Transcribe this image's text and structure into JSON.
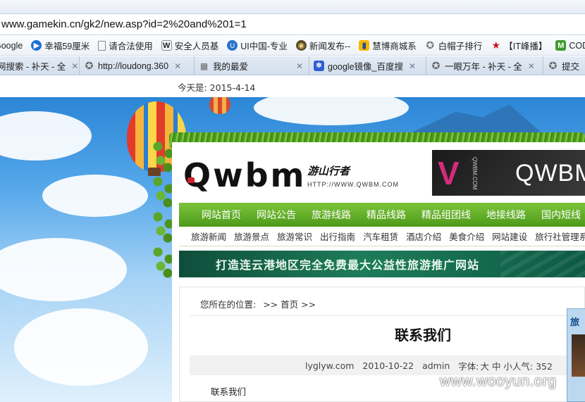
{
  "browser": {
    "address": "www.gamekin.cn/gk2/new.asp?id=2%20and%201=1",
    "bookmarks": [
      {
        "label": "Google",
        "icon": "google-icon"
      },
      {
        "label": "幸福59厘米",
        "icon": "play-circle-icon"
      },
      {
        "label": "请合法使用",
        "icon": "page-icon"
      },
      {
        "label": "安全人员基",
        "icon": "wikipedia-icon"
      },
      {
        "label": "UI中国-专业",
        "icon": "ui-china-icon"
      },
      {
        "label": "新闻发布--",
        "icon": "globe-icon"
      },
      {
        "label": "慧博商城系",
        "icon": "huibo-icon"
      },
      {
        "label": "白帽子排行",
        "icon": "star-outline-icon"
      },
      {
        "label": "【IT峰播】",
        "icon": "red-star-icon"
      },
      {
        "label": "CODEC",
        "icon": "codec-icon"
      }
    ],
    "tabs": [
      {
        "label": "网搜索 - 补天 - 全",
        "icon": "none"
      },
      {
        "label": "http://loudong.360",
        "icon": "star-outline-icon"
      },
      {
        "label": "我的最爱",
        "icon": "grid-icon"
      },
      {
        "label": "google镜像_百度搜",
        "icon": "baidu-paw-icon"
      },
      {
        "label": "一眼万年 - 补天 - 全",
        "icon": "star-outline-icon"
      },
      {
        "label": "提交",
        "icon": "star-outline-icon"
      }
    ],
    "today": "今天是: 2015-4-14"
  },
  "site": {
    "logo_text": "Qwbm",
    "logo_cn": "游山行者",
    "logo_url": "HTTP://WWW.QWBM.COM",
    "banner_v": "V",
    "banner_small": "QWBM.COM",
    "banner_text": "QWBM",
    "main_nav": [
      "网站首页",
      "网站公告",
      "旅游线路",
      "精品线路",
      "精品组团线",
      "地接线路",
      "国内短线"
    ],
    "sub_nav": [
      "旅游新闻",
      "旅游景点",
      "旅游常识",
      "出行指南",
      "汽车租赁",
      "酒店介绍",
      "美食介绍",
      "网站建设",
      "旅行社管理系统"
    ],
    "slogan": "打造连云港地区完全免费最大公益性旅游推广网站"
  },
  "article": {
    "breadcrumb_label": "您所在的位置:",
    "breadcrumb_path": ">> 首页 >>",
    "title": "联系我们",
    "meta": {
      "source": "lyglyw.com",
      "date": "2010-10-22",
      "author": "admin",
      "font_label": "字体:",
      "font_sizes": "大 中 小",
      "views": "人气: 352"
    },
    "body": "联系我们"
  },
  "side_widget": {
    "title": "旅"
  },
  "watermark": "www.wooyun.org"
}
